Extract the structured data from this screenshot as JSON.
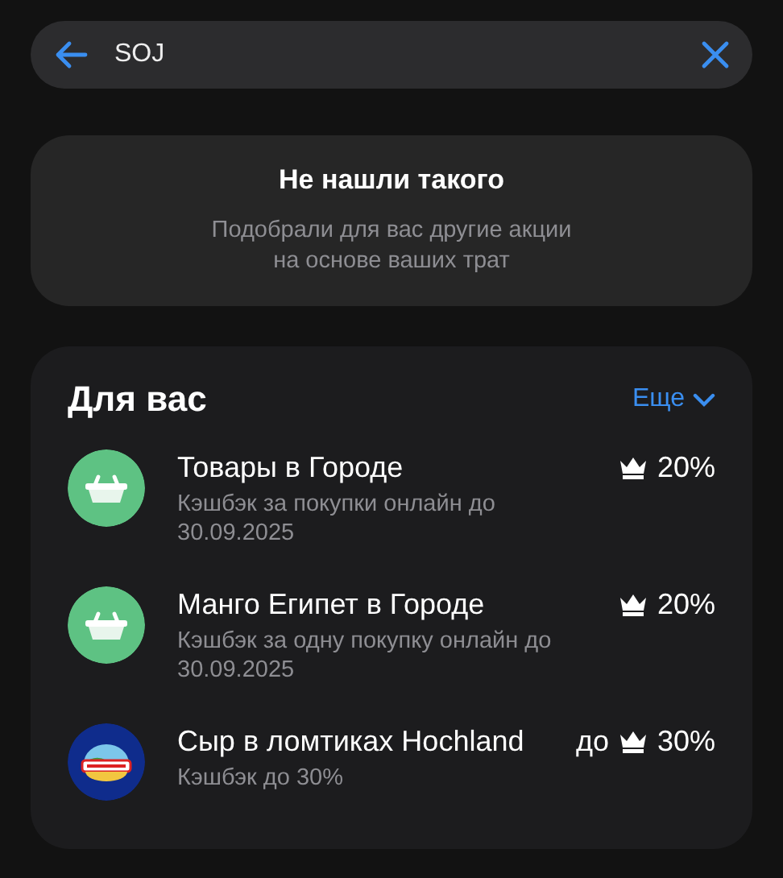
{
  "search": {
    "value": "SOJ"
  },
  "empty_state": {
    "title": "Не нашли такого",
    "text": "Подобрали для вас другие акции\nна основе ваших трат"
  },
  "offers": {
    "title": "Для вас",
    "more": "Еще",
    "items": [
      {
        "kind": "basket",
        "title": "Товары в Городе",
        "subtitle": "Кэшбэк за покупки онлайн до 30.09.2025",
        "cashback": "20%"
      },
      {
        "kind": "basket",
        "title": "Манго Египет в Городе",
        "subtitle": "Кэшбэк за одну покупку онлайн до 30.09.2025",
        "cashback": "20%"
      },
      {
        "kind": "brand",
        "title": "Сыр в ломтиках Hochland",
        "subtitle": "Кэшбэк до 30%",
        "prefix": "до",
        "cashback": "30%"
      }
    ]
  }
}
